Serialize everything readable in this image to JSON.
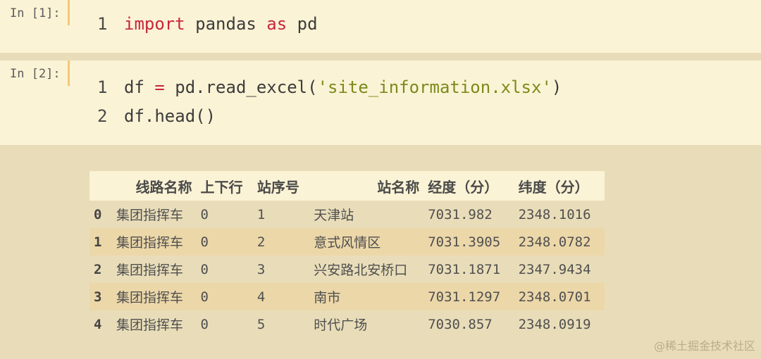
{
  "cells": [
    {
      "prompt": "In [1]:",
      "lines": [
        {
          "num": "1",
          "tokens": [
            {
              "t": "import",
              "c": "kw"
            },
            {
              "t": " pandas ",
              "c": ""
            },
            {
              "t": "as",
              "c": "kw"
            },
            {
              "t": " pd",
              "c": ""
            }
          ]
        }
      ]
    },
    {
      "prompt": "In [2]:",
      "lines": [
        {
          "num": "1",
          "tokens": [
            {
              "t": "df ",
              "c": ""
            },
            {
              "t": "=",
              "c": "op"
            },
            {
              "t": " pd.read_excel(",
              "c": ""
            },
            {
              "t": "'site_information.xlsx'",
              "c": "str"
            },
            {
              "t": ")",
              "c": ""
            }
          ]
        },
        {
          "num": "2",
          "tokens": [
            {
              "t": "df.head()",
              "c": ""
            }
          ]
        }
      ]
    }
  ],
  "table": {
    "headers": [
      "",
      "线路名称",
      "上下行",
      "站序号",
      "站名称",
      "经度（分）",
      "纬度（分）"
    ],
    "rows": [
      [
        "0",
        "集团指挥车",
        "0",
        "1",
        "天津站",
        "7031.982",
        "2348.1016"
      ],
      [
        "1",
        "集团指挥车",
        "0",
        "2",
        "意式风情区",
        "7031.3905",
        "2348.0782"
      ],
      [
        "2",
        "集团指挥车",
        "0",
        "3",
        "兴安路北安桥口",
        "7031.1871",
        "2347.9434"
      ],
      [
        "3",
        "集团指挥车",
        "0",
        "4",
        "南市",
        "7031.1297",
        "2348.0701"
      ],
      [
        "4",
        "集团指挥车",
        "0",
        "5",
        "时代广场",
        "7030.857",
        "2348.0919"
      ]
    ]
  },
  "watermark": "@稀土掘金技术社区"
}
